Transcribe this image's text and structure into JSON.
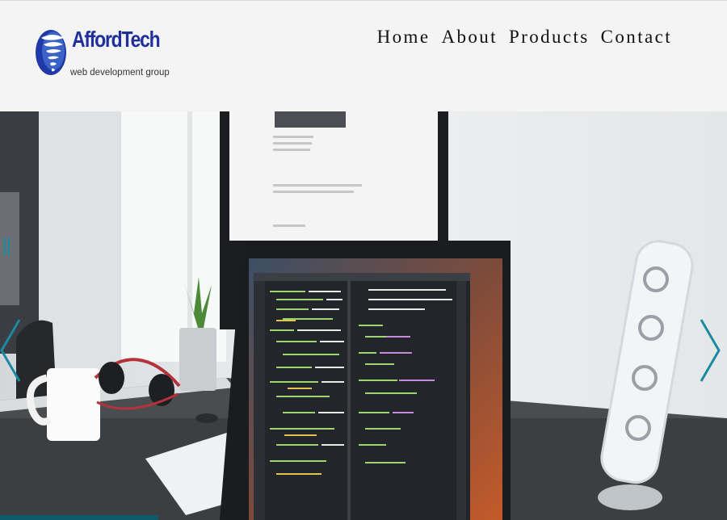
{
  "brand": {
    "name": "AffordTech",
    "tagline": "web development group",
    "colors": {
      "primary": "#1f2f9c",
      "accent": "#1a8aa0"
    },
    "logo_icon": "tornado-globe-icon"
  },
  "nav": {
    "items": [
      {
        "label": "Home"
      },
      {
        "label": "About"
      },
      {
        "label": "Products"
      },
      {
        "label": "Contact"
      }
    ]
  },
  "hero": {
    "scene": "desk with laptop showing code editor, external monitor, mug, headphones, plant and speaker",
    "controls": {
      "prev_icon": "chevron-left-icon",
      "next_icon": "chevron-right-icon",
      "indicator_icon": "pause-bars-icon"
    }
  }
}
